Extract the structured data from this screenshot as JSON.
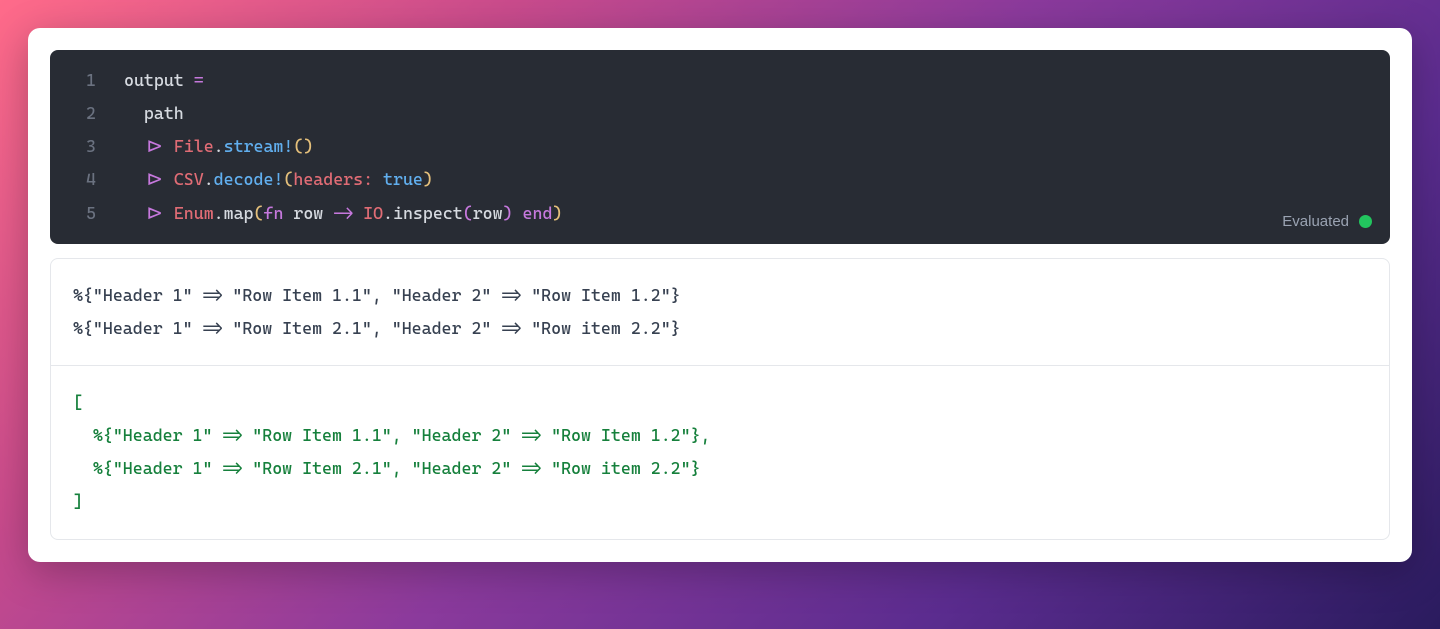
{
  "code": {
    "lines": [
      "1",
      "2",
      "3",
      "4",
      "5"
    ],
    "l1": {
      "a": "output ",
      "b": "="
    },
    "l2": {
      "a": "path"
    },
    "l3": {
      "pipe": "|>",
      "mod": "File",
      "dot": ".",
      "fn": "stream!",
      "po": "(",
      "pc": ")"
    },
    "l4": {
      "pipe": "|>",
      "mod": "CSV",
      "dot": ".",
      "fn": "decode!",
      "po": "(",
      "k": "headers:",
      "sp": " ",
      "v": "true",
      "pc": ")"
    },
    "l5": {
      "pipe": "|>",
      "mod": "Enum",
      "dot": ".",
      "fn": "map",
      "po": "(",
      "kw1": "fn",
      "sp1": " ",
      "arg": "row ",
      "arrow": "->",
      "sp2": " ",
      "mod2": "IO",
      "dot2": ".",
      "fn2": "inspect",
      "po2": "(",
      "arg2": "row",
      "pc2": ")",
      "sp3": " ",
      "kw2": "end",
      "pc": ")"
    }
  },
  "status": {
    "label": "Evaluated"
  },
  "output": {
    "stdout": "%{\"Header 1\" => \"Row Item 1.1\", \"Header 2\" => \"Row Item 1.2\"}\n%{\"Header 1\" => \"Row Item 2.1\", \"Header 2\" => \"Row item 2.2\"}",
    "result": "[\n  %{\"Header 1\" => \"Row Item 1.1\", \"Header 2\" => \"Row Item 1.2\"},\n  %{\"Header 1\" => \"Row Item 2.1\", \"Header 2\" => \"Row item 2.2\"}\n]"
  }
}
